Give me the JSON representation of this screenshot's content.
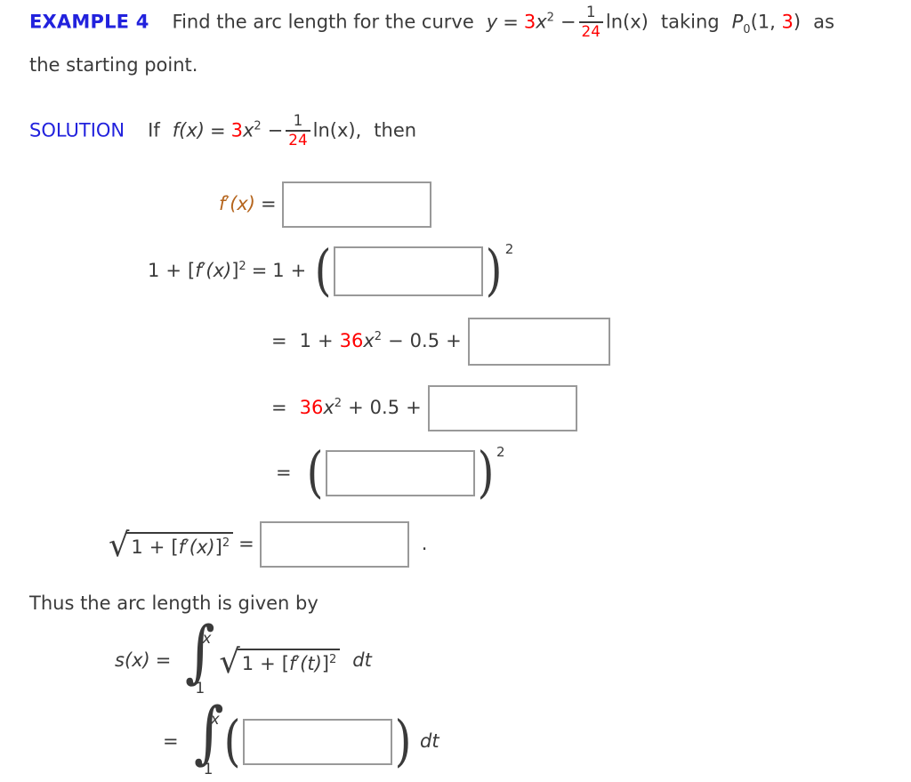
{
  "problem": {
    "label": "EXAMPLE 4",
    "prompt_part1": "Find the arc length for the curve",
    "equation": {
      "lhs": "y",
      "equals": "=",
      "coefficient": "3",
      "variable": "x",
      "exponent": "2",
      "minus": "−",
      "fraction_numerator": "1",
      "fraction_denominator": "24",
      "log": "ln(x)"
    },
    "prompt_part2": "taking",
    "point_label": "P",
    "point_subscript": "0",
    "point_x": "1",
    "point_y": "3",
    "prompt_part3": "as",
    "prompt_part4": "the starting point."
  },
  "solution": {
    "label": "SOLUTION",
    "intro": "If",
    "f_of_x": "f(x)",
    "equals": "=",
    "coefficient": "3",
    "variable": "x",
    "exponent": "2",
    "minus": "−",
    "fraction_numerator": "1",
    "fraction_denominator": "24",
    "log": "ln(x),",
    "then": "then"
  },
  "steps": {
    "fprime": {
      "label_f": "f",
      "label_prime": "′",
      "label_arg": "(x)",
      "equals": "=",
      "answer": ""
    },
    "one_plus_fprime_sq": {
      "one": "1",
      "plus": "+",
      "bracket_open": "[",
      "f": "f",
      "prime": "′",
      "arg": "(x)",
      "bracket_close": "]",
      "exponent": "2",
      "equals": "=",
      "rhs_one": "1",
      "rhs_plus": "+",
      "paren_open": "(",
      "answer": "",
      "paren_close": ")",
      "paren_exponent": "2"
    },
    "expand_one": {
      "equals": "=",
      "one": "1",
      "plus1": "+",
      "coefficient": "36",
      "variable": "x",
      "exponent": "2",
      "minus": "−",
      "half": "0.5",
      "plus2": "+",
      "answer": ""
    },
    "expand_two": {
      "equals": "=",
      "coefficient": "36",
      "variable": "x",
      "exponent": "2",
      "plus1": "+",
      "half": "0.5",
      "plus2": "+",
      "answer": ""
    },
    "squared_form": {
      "equals": "=",
      "paren_open": "(",
      "answer": "",
      "paren_close": ")",
      "paren_exponent": "2"
    },
    "sqrt_form": {
      "radical": "√",
      "one": "1",
      "plus": "+",
      "bracket_open": "[",
      "f": "f",
      "prime": "′",
      "arg": "(x)",
      "bracket_close": "]",
      "exponent": "2",
      "equals": "=",
      "answer": "",
      "period": "."
    }
  },
  "arc_length": {
    "intro": "Thus the arc length is given by",
    "s_of_x": "s(x)",
    "equals": "=",
    "integral_upper": "x",
    "integral_lower": "1",
    "radical": "√",
    "one": "1",
    "plus": "+",
    "bracket_open": "[",
    "f": "f",
    "prime": "′",
    "arg": "(t)",
    "bracket_close": "]",
    "exponent": "2",
    "differential": "dt"
  },
  "final_step": {
    "equals": "=",
    "integral_upper": "x",
    "integral_lower": "1",
    "paren_open": "(",
    "answer": "",
    "paren_close": ")",
    "differential": "dt"
  },
  "colors": {
    "heading_blue": "#2222dd",
    "accent_red": "#ff0000",
    "body_dark": "#3a3a3a",
    "box_border": "#999999",
    "fprime_orange": "#b5651d"
  }
}
